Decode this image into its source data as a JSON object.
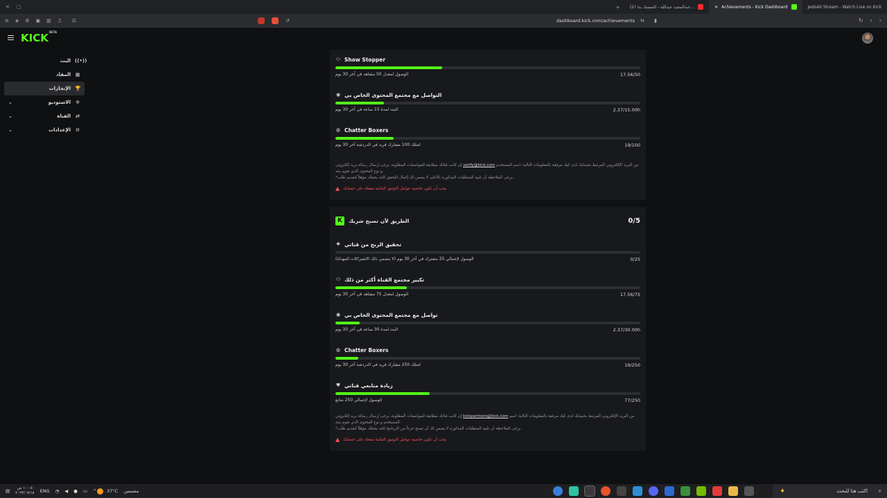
{
  "browser": {
    "tabs": [
      {
        "label": "(2) عبدالمجيد عبدالله - التمسك بدا...",
        "color": "#ff2d2d"
      },
      {
        "label": "Achievements - Kick Dashboard",
        "color": "#53fc18"
      },
      {
        "label": "JedoAli Stream - Watch Live on Kick",
        "color": "#53fc18"
      }
    ],
    "url": "dashboard.kick.com/achievements"
  },
  "header": {
    "logo": "KICK",
    "logo_badge": "BETA"
  },
  "sidebar": {
    "items": [
      {
        "label": "البث",
        "icon": "broadcast-icon",
        "glyph": "((•))",
        "chevron": false
      },
      {
        "label": "المقاد",
        "icon": "dashboard-icon",
        "glyph": "▦",
        "chevron": false
      },
      {
        "label": "الإنجازات",
        "icon": "trophy-icon",
        "glyph": "🏆",
        "chevron": false,
        "active": true
      },
      {
        "label": "الاستوديو",
        "icon": "studio-icon",
        "glyph": "✲",
        "chevron": true
      },
      {
        "label": "القناة",
        "icon": "channel-icon",
        "glyph": "⇄",
        "chevron": true
      },
      {
        "label": "الإعدادات",
        "icon": "gear-icon",
        "glyph": "⚙",
        "chevron": true
      }
    ]
  },
  "section1": {
    "achievements": [
      {
        "title": "Show Stopper",
        "icon": "users-icon",
        "glyph": "⚇",
        "progress": 0.35,
        "desc": "الوصول لمعدل 50 مشاهد في آخر 30 يوم",
        "value": "17.56/50"
      },
      {
        "title": "التواصل مع مجتمع المحتوى الخاص بي",
        "icon": "live-icon",
        "glyph": "◉",
        "progress": 0.158,
        "desc": "البث لمدة 15 ساعة في آخر 30 يوم",
        "value": "2.37/15.00h"
      },
      {
        "title": "Chatter Boxers",
        "icon": "chat-icon",
        "glyph": "◍",
        "progress": 0.19,
        "desc": "امتلك 100 مشارك فريد في الدردشة آخر 30 يوم",
        "value": "19/100"
      }
    ],
    "note_line1_a": "إن كانت قناتك مطابقة للمواصفات المطلوبة، يرجى إرسال رسالة بريد إلكتروني",
    "note_mail": "verify@kick.com",
    "note_line1_b": "من البريد الإلكتروني المرتبط بحسابك لدى كيك مرفقة بالمعلومات التالية: اسم المستخدم و نوع المحتوى الذي تقوم ببثه.",
    "note_line2": "*يرجى الملاحظة أن تلبية المتطلبات المذكورة بالأعلى لا يضمن لك إكمال التحقق لكنه يجعلك مؤهلاً لتقديم طلب.",
    "warning": "يجب أن تكون خاصية عوامل التوثيق الثنائية مفعلة على حسابك"
  },
  "section2": {
    "title": "الطريق لأن تصبح شريك",
    "count": "0/5",
    "achievements": [
      {
        "title": "تحقيق الربح من قناتي",
        "icon": "money-icon",
        "glyph": "✚",
        "progress": 0.0,
        "desc": "الوصول لإجمالي 25 مشترك في آخر 30 يوم (لا يتضمن ذلك الاشتراكات المهداة)",
        "value": "0/25"
      },
      {
        "title": "تكبير مجتمع القناة أكثر من ذلك",
        "icon": "users-icon",
        "glyph": "⚇",
        "progress": 0.234,
        "desc": "الوصول لمعدل 75 مشاهد في آخر 30 يوم",
        "value": "17.56/75"
      },
      {
        "title": "تواصل مع مجتمع المحتوى الخاص بي",
        "icon": "live-icon",
        "glyph": "◉",
        "progress": 0.079,
        "desc": "البث لمدة 30 ساعة في آخر 30 يوم",
        "value": "2.37/30.00h"
      },
      {
        "title": "Chatter Boxers",
        "icon": "chat-icon",
        "glyph": "◍",
        "progress": 0.076,
        "desc": "امتلك 250 مشارك فريد في الدردشة آخر 30 يوم",
        "value": "19/250"
      },
      {
        "title": "زيادة متابعي قناتي",
        "icon": "heart-icon",
        "glyph": "♥",
        "progress": 0.308,
        "desc": "الوصول لإجمالي 250 متابع",
        "value": "77/250"
      }
    ],
    "note_line1_a": "إن كانت قناتك مطابقة للمواصفات المطلوبة، يرجى إرسال رسالة بريد إلكتروني",
    "note_mail": "kickpartners@kick.com",
    "note_line1_b": "من البريد الإلكتروني المرتبط بحسابك لدى كيك مرفقة بالمعلومات التالية: اسم المستخدم و نوع المحتوى الذي تقوم ببثه.",
    "note_line2": "*يرجى الملاحظة أن تلبية المتطلبات المذكورة لا يضمن لك أن تصبح جزءاً من البرنامج لكنه يجعلك مؤهلاً لتقديم طلب.",
    "warning": "يجب أن تكون خاصية عوامل التوثيق الثنائية مفعلة على حسابك"
  },
  "taskbar": {
    "time": "١٠:٠٥ ص",
    "date": "٢٠٢٣/٠٧/١٨",
    "lang": "ENG",
    "weather_temp": "37°C",
    "weather_text": "مشمس",
    "search_placeholder": "اكتب هنا للبحث"
  },
  "colors": {
    "accent": "#53fc18",
    "warning": "#ff4d5e",
    "card": "#18191c",
    "background": "#0f1012"
  }
}
